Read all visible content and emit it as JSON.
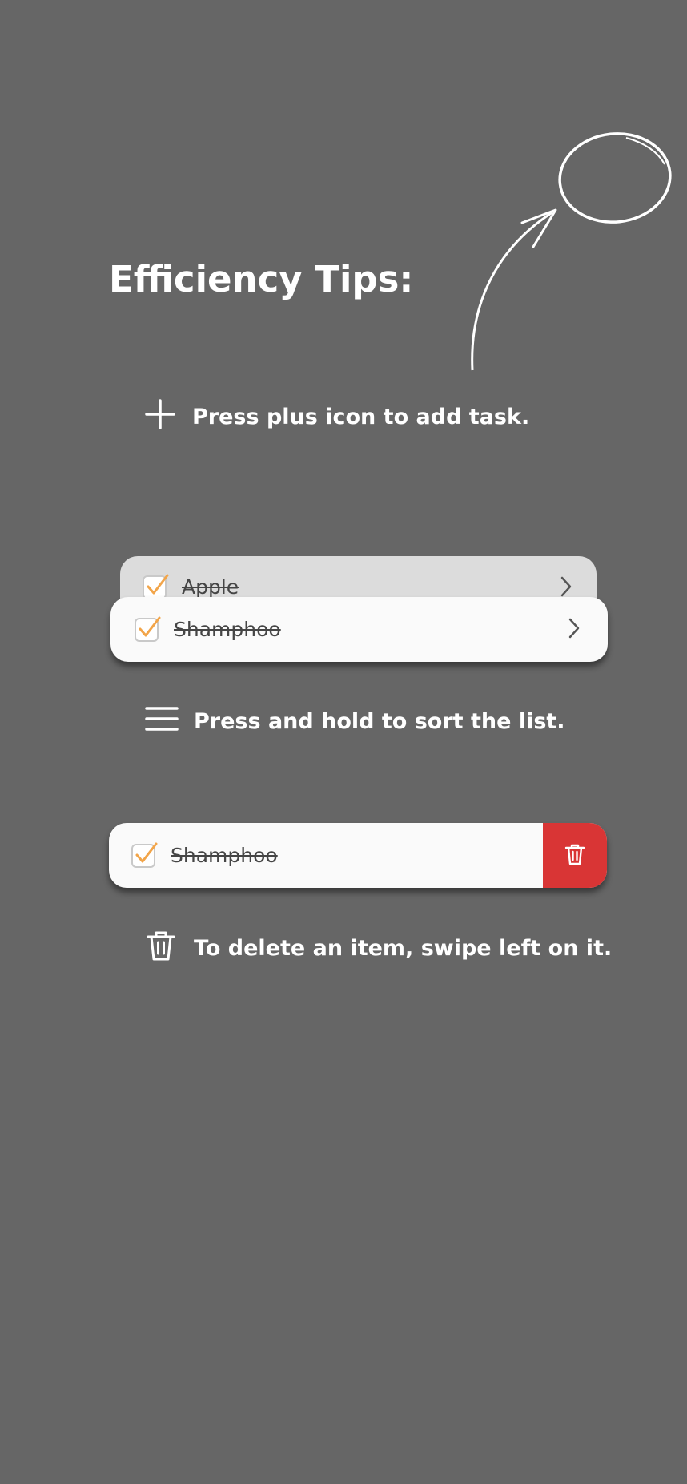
{
  "title": "Efficiency Tips:",
  "tips": {
    "add": {
      "text": "Press plus icon to add task.",
      "icon": "plus-icon"
    },
    "sort": {
      "text": "Press and hold to sort the list.",
      "icon": "drag-handle-icon"
    },
    "delete": {
      "text": "To delete an item, swipe left on it.",
      "icon": "trash-icon"
    }
  },
  "examples": {
    "sort_back_item": {
      "label": "Apple",
      "checked": true
    },
    "sort_front_item": {
      "label": "Shamphoo",
      "checked": true
    },
    "swipe_item": {
      "label": "Shamphoo",
      "checked": true
    }
  },
  "colors": {
    "background": "#666666",
    "card": "#fafafa",
    "card_back": "#dcdcdc",
    "check": "#f2a54a",
    "delete": "#d93535",
    "text": "#ffffff"
  }
}
